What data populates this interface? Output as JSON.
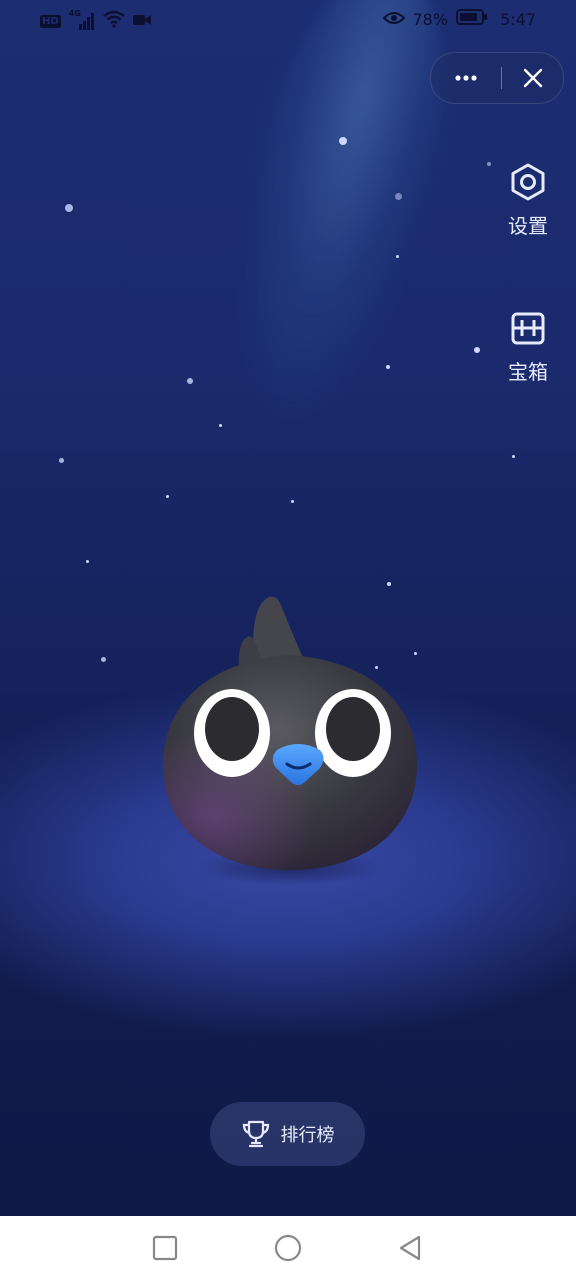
{
  "status_bar": {
    "hd_label": "HD",
    "network_label": "4G",
    "battery_percent": "78%",
    "time": "5:47",
    "icons": [
      "hd-icon",
      "signal-icon",
      "wifi-icon",
      "video-icon",
      "eye-icon",
      "battery-icon"
    ]
  },
  "capsule": {
    "more_icon": "more-icon",
    "close_icon": "close-icon"
  },
  "side_menu": {
    "settings_label": "设置",
    "settings_icon": "hexagon-gear-icon",
    "treasure_label": "宝箱",
    "treasure_icon": "treasure-box-icon"
  },
  "leaderboard": {
    "label": "排行榜",
    "icon": "trophy-icon"
  },
  "nav_bar": {
    "icons": [
      "square-icon",
      "circle-icon",
      "back-triangle-icon"
    ]
  },
  "colors": {
    "background_top": "#1c2d72",
    "background_bottom": "#101a48",
    "spotlight": "#3a4aa8",
    "beak_blue": "#3a8cf0",
    "text_light": "#e6ebff"
  }
}
